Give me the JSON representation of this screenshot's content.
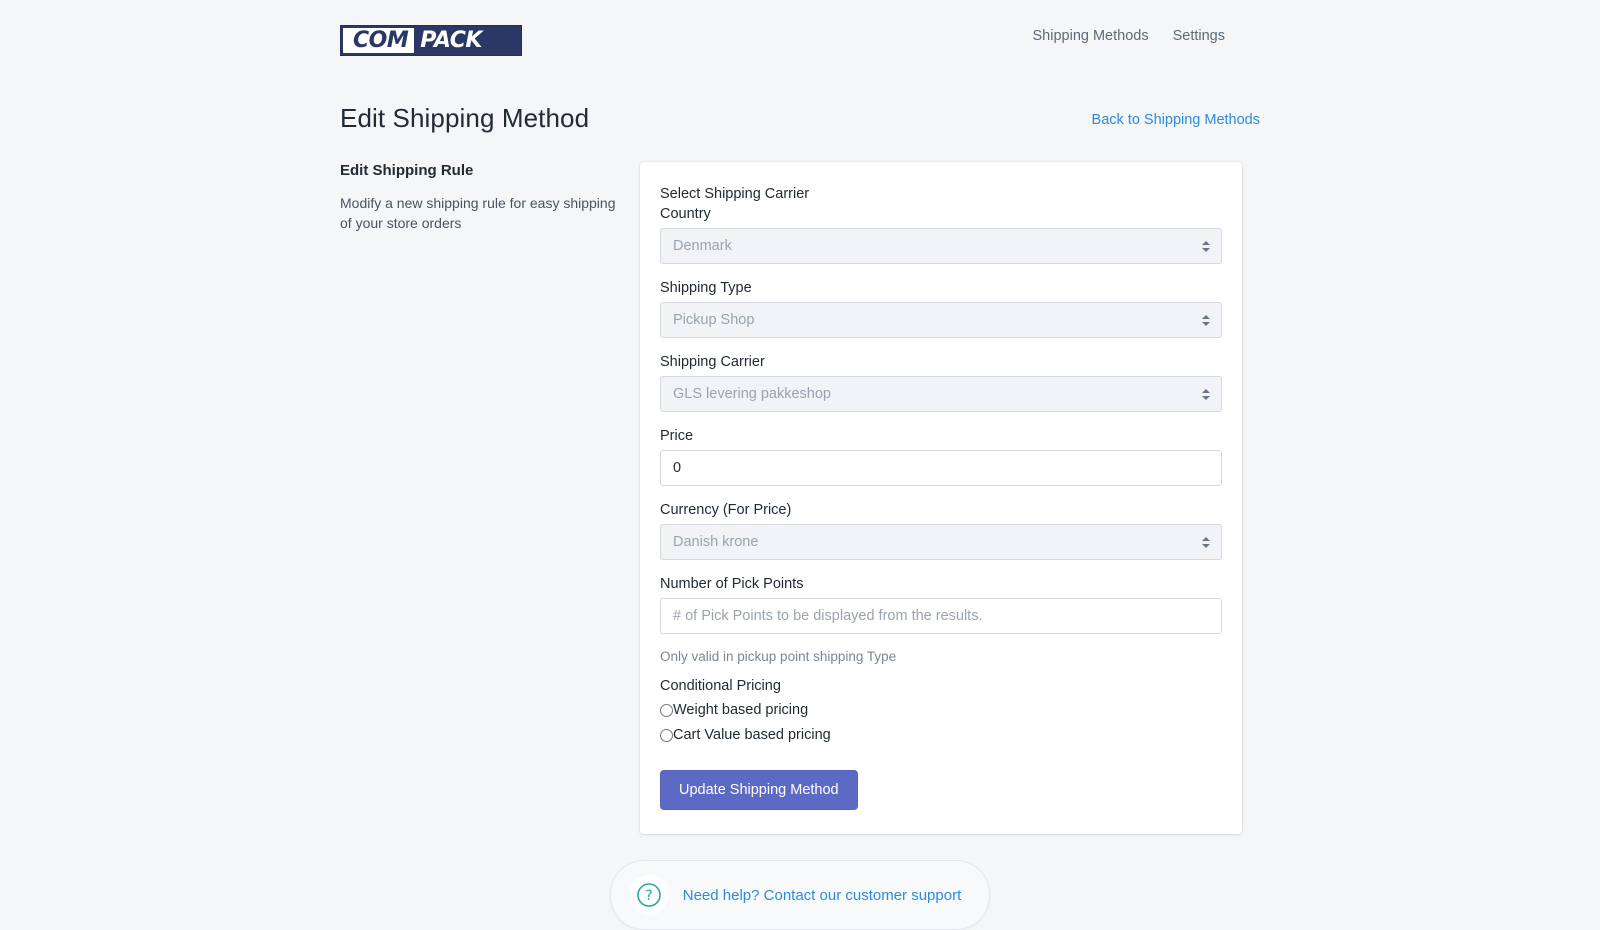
{
  "brand": {
    "logo_left": "COM",
    "logo_right": "PACK"
  },
  "topnav": {
    "items": [
      {
        "label": "Shipping Methods"
      },
      {
        "label": "Settings"
      }
    ]
  },
  "header": {
    "title": "Edit Shipping Method",
    "back_link": "Back to Shipping Methods"
  },
  "sidebar": {
    "title": "Edit Shipping Rule",
    "description": "Modify a new shipping rule for easy shipping of your store orders"
  },
  "form": {
    "section_title": "Select Shipping Carrier",
    "country": {
      "label": "Country",
      "value": "Denmark"
    },
    "shipping_type": {
      "label": "Shipping Type",
      "value": "Pickup Shop"
    },
    "shipping_carrier": {
      "label": "Shipping Carrier",
      "value": "GLS levering pakkeshop"
    },
    "price": {
      "label": "Price",
      "value": "0"
    },
    "currency": {
      "label": "Currency (For Price)",
      "value": "Danish krone"
    },
    "pick_points": {
      "label": "Number of Pick Points",
      "placeholder": "# of Pick Points to be displayed from the results.",
      "value": "",
      "hint": "Only valid in pickup point shipping Type"
    },
    "conditional_pricing": {
      "label": "Conditional Pricing",
      "options": [
        {
          "label": "Weight based pricing",
          "checked": false
        },
        {
          "label": "Cart Value based pricing",
          "checked": false
        }
      ]
    },
    "submit_label": "Update Shipping Method"
  },
  "support": {
    "icon": "question-circle-icon",
    "link_text": "Need help? Contact our customer support"
  },
  "colors": {
    "page_background": "#f4f6f8",
    "brand_navy": "#2b3764",
    "primary_button": "#5c6ac4",
    "link_blue": "#2e8bdc",
    "help_icon_teal": "#2aa79b"
  }
}
